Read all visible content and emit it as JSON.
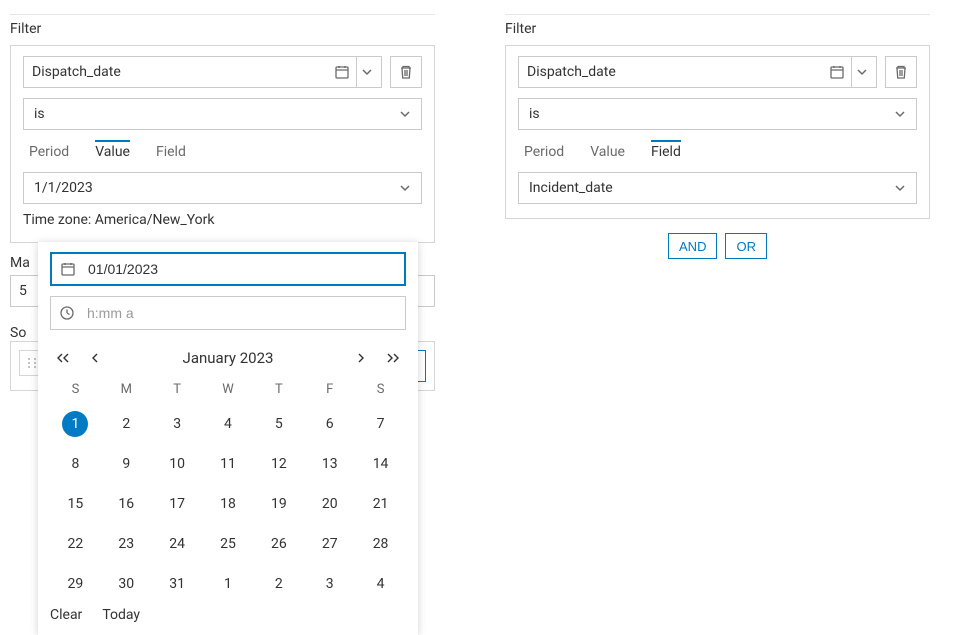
{
  "left": {
    "title": "Filter",
    "field": "Dispatch_date",
    "operator": "is",
    "tabs": {
      "period": "Period",
      "value": "Value",
      "field": "Field",
      "active": "value"
    },
    "value": "1/1/2023",
    "timezone": "Time zone: America/New_York",
    "max_label": "Ma",
    "max_value": "5",
    "sort_label": "So"
  },
  "right": {
    "title": "Filter",
    "field": "Dispatch_date",
    "operator": "is",
    "tabs": {
      "period": "Period",
      "value": "Value",
      "field": "Field",
      "active": "field"
    },
    "field_value": "Incident_date",
    "logic": {
      "and": "AND",
      "or": "OR"
    }
  },
  "calendar": {
    "date_value": "01/01/2023",
    "time_placeholder": "h:mm a",
    "month": "January 2023",
    "dow": [
      "S",
      "M",
      "T",
      "W",
      "T",
      "F",
      "S"
    ],
    "rows": [
      [
        {
          "n": 1,
          "sel": true
        },
        {
          "n": 2
        },
        {
          "n": 3
        },
        {
          "n": 4
        },
        {
          "n": 5
        },
        {
          "n": 6
        },
        {
          "n": 7
        }
      ],
      [
        {
          "n": 8
        },
        {
          "n": 9
        },
        {
          "n": 10
        },
        {
          "n": 11
        },
        {
          "n": 12
        },
        {
          "n": 13
        },
        {
          "n": 14
        }
      ],
      [
        {
          "n": 15
        },
        {
          "n": 16
        },
        {
          "n": 17
        },
        {
          "n": 18
        },
        {
          "n": 19
        },
        {
          "n": 20
        },
        {
          "n": 21
        }
      ],
      [
        {
          "n": 22
        },
        {
          "n": 23
        },
        {
          "n": 24
        },
        {
          "n": 25
        },
        {
          "n": 26
        },
        {
          "n": 27
        },
        {
          "n": 28
        }
      ],
      [
        {
          "n": 29
        },
        {
          "n": 30
        },
        {
          "n": 31
        },
        {
          "n": 1,
          "out": true
        },
        {
          "n": 2,
          "out": true
        },
        {
          "n": 3,
          "out": true
        },
        {
          "n": 4,
          "out": true
        }
      ]
    ],
    "clear": "Clear",
    "today": "Today"
  }
}
